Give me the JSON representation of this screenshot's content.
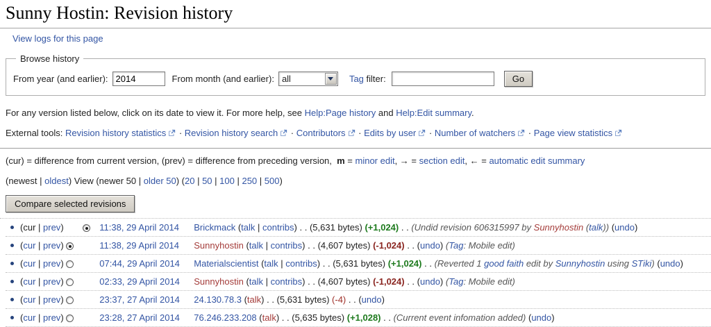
{
  "page": {
    "title": "Sunny Hostin: Revision history",
    "view_logs": "View logs for this page"
  },
  "browse": {
    "legend": "Browse history",
    "year_label": "From year (and earlier):",
    "year_value": "2014",
    "month_label": "From month (and earlier):",
    "month_value": "all",
    "tag_link": "Tag",
    "tag_rest": " filter:",
    "go": "Go"
  },
  "help": {
    "text1": "For any version listed below, click on its date to view it. For more help, see ",
    "link1": "Help:Page history",
    "text2": " and ",
    "link2": "Help:Edit summary",
    "text3": "."
  },
  "external_tools": {
    "label": "External tools: ",
    "separator": "·",
    "links": [
      "Revision history statistics",
      "Revision history search",
      "Contributors",
      "Edits by user",
      "Number of watchers",
      "Page view statistics"
    ]
  },
  "legend_line": {
    "p1": "(cur) = difference from current version, (prev) = difference from preceding version,  ",
    "m": "m",
    "p2": " = ",
    "minor_link": "minor edit",
    "p3": ", → = ",
    "section_link": "section edit",
    "p4": ", ← = ",
    "auto_link": "automatic edit summary"
  },
  "nav": {
    "p1": "(newest | ",
    "oldest_link": "oldest",
    "p2": ") View (newer 50 | ",
    "older_link": "older 50",
    "p3": ") (",
    "counts": [
      "20",
      "50",
      "100",
      "250",
      "500"
    ],
    "count_sep": " | ",
    "p4": ")"
  },
  "compare_button": "Compare selected revisions",
  "row_tokens": {
    "open": "(",
    "pipe": " | ",
    "close": ")",
    "dots": " . . "
  },
  "rows": [
    {
      "cur": "cur",
      "cur_is_link": false,
      "prev": "prev",
      "radio1": "none",
      "radio2": "checked",
      "date": "11:38, 29 April 2014",
      "user": "Brickmack",
      "user_color": "blue",
      "talk": "talk",
      "talk_color": "blue",
      "contribs": "contribs",
      "size": "(5,631 bytes)",
      "change": "(+1,024)",
      "change_class": "pos",
      "after": [
        {
          "t": " . . ",
          "s": "t"
        },
        {
          "t": "(Undid revision 606315997 by ",
          "s": "c"
        },
        {
          "t": "Sunnyhostin",
          "s": "crl"
        },
        {
          "t": " (",
          "s": "c"
        },
        {
          "t": "talk",
          "s": "cl"
        },
        {
          "t": "))",
          "s": "c"
        },
        {
          "t": " (",
          "s": "t"
        },
        {
          "t": "undo",
          "s": "l"
        },
        {
          "t": ")",
          "s": "t"
        }
      ]
    },
    {
      "cur": "cur",
      "cur_is_link": true,
      "prev": "prev",
      "radio1": "checked",
      "radio2": "none",
      "date": "11:38, 29 April 2014",
      "user": "Sunnyhostin",
      "user_color": "red",
      "talk": "talk",
      "talk_color": "blue",
      "contribs": "contribs",
      "size": "(4,607 bytes)",
      "change": "(-1,024)",
      "change_class": "neg",
      "after": [
        {
          "t": " . . ",
          "s": "t"
        },
        {
          "t": "(",
          "s": "t"
        },
        {
          "t": "undo",
          "s": "l"
        },
        {
          "t": ")",
          "s": "t"
        },
        {
          "t": " (",
          "s": "c"
        },
        {
          "t": "Tag",
          "s": "cl"
        },
        {
          "t": ": Mobile edit)",
          "s": "c"
        }
      ]
    },
    {
      "cur": "cur",
      "cur_is_link": true,
      "prev": "prev",
      "radio1": "unchecked",
      "radio2": "none",
      "date": "07:44, 29 April 2014",
      "user": "Materialscientist",
      "user_color": "blue",
      "talk": "talk",
      "talk_color": "blue",
      "contribs": "contribs",
      "size": "(5,631 bytes)",
      "change": "(+1,024)",
      "change_class": "pos",
      "after": [
        {
          "t": " . . ",
          "s": "t"
        },
        {
          "t": "(Reverted 1 ",
          "s": "c"
        },
        {
          "t": "good faith",
          "s": "cl"
        },
        {
          "t": " edit by ",
          "s": "c"
        },
        {
          "t": "Sunnyhostin",
          "s": "cl"
        },
        {
          "t": " using ",
          "s": "c"
        },
        {
          "t": "STiki",
          "s": "cl"
        },
        {
          "t": ")",
          "s": "c"
        },
        {
          "t": " (",
          "s": "t"
        },
        {
          "t": "undo",
          "s": "l"
        },
        {
          "t": ")",
          "s": "t"
        }
      ]
    },
    {
      "cur": "cur",
      "cur_is_link": true,
      "prev": "prev",
      "radio1": "unchecked",
      "radio2": "none",
      "date": "02:33, 29 April 2014",
      "user": "Sunnyhostin",
      "user_color": "red",
      "talk": "talk",
      "talk_color": "blue",
      "contribs": "contribs",
      "size": "(4,607 bytes)",
      "change": "(-1,024)",
      "change_class": "neg",
      "after": [
        {
          "t": " . . ",
          "s": "t"
        },
        {
          "t": "(",
          "s": "t"
        },
        {
          "t": "undo",
          "s": "l"
        },
        {
          "t": ")",
          "s": "t"
        },
        {
          "t": " (",
          "s": "c"
        },
        {
          "t": "Tag",
          "s": "cl"
        },
        {
          "t": ": Mobile edit)",
          "s": "c"
        }
      ]
    },
    {
      "cur": "cur",
      "cur_is_link": true,
      "prev": "prev",
      "radio1": "unchecked",
      "radio2": "none",
      "date": "23:37, 27 April 2014",
      "user": "24.130.78.3",
      "user_color": "blue",
      "talk": "talk",
      "talk_color": "red",
      "contribs": null,
      "size": "(5,631 bytes)",
      "change": "(-4)",
      "change_class": "negsm",
      "after": [
        {
          "t": " . . ",
          "s": "t"
        },
        {
          "t": "(",
          "s": "t"
        },
        {
          "t": "undo",
          "s": "l"
        },
        {
          "t": ")",
          "s": "t"
        }
      ]
    },
    {
      "cur": "cur",
      "cur_is_link": true,
      "prev": "prev",
      "radio1": "unchecked",
      "radio2": "none",
      "date": "23:28, 27 April 2014",
      "user": "76.246.233.208",
      "user_color": "blue",
      "talk": "talk",
      "talk_color": "red",
      "contribs": null,
      "size": "(5,635 bytes)",
      "change": "(+1,028)",
      "change_class": "pos",
      "after": [
        {
          "t": " . . ",
          "s": "t"
        },
        {
          "t": "(Current event infomation added)",
          "s": "c"
        },
        {
          "t": " (",
          "s": "t"
        },
        {
          "t": "undo",
          "s": "l"
        },
        {
          "t": ")",
          "s": "t"
        }
      ]
    }
  ]
}
